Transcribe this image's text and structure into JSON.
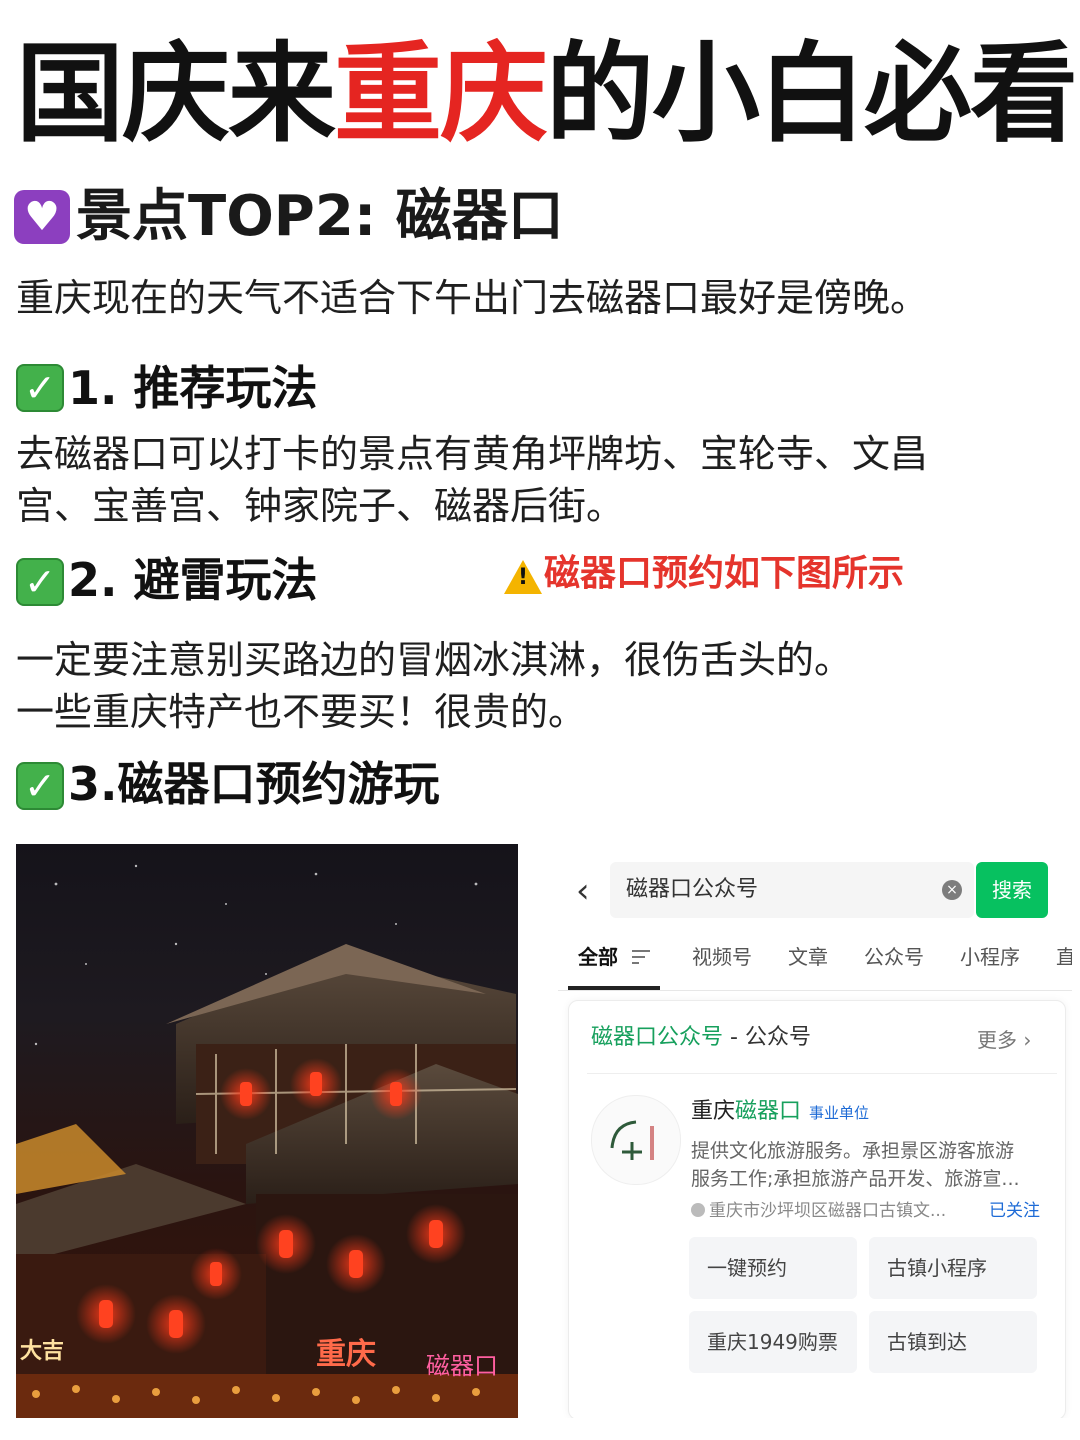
{
  "title": {
    "part1": "国庆来",
    "highlight": "重庆",
    "part2": "的小白必看"
  },
  "section": {
    "heart_icon": "purple-heart",
    "title": "景点TOP2: 磁器口"
  },
  "intro": "重庆现在的天气不适合下午出门去磁器口最好是傍晚。",
  "items": [
    {
      "check_icon": "check-mark",
      "heading": "1. 推荐玩法",
      "lines": [
        "去磁器口可以打卡的景点有黄角坪牌坊、宝轮寺、文昌",
        "宫、宝善宫、钟家院子、磁器后街。"
      ]
    },
    {
      "check_icon": "check-mark",
      "heading": "2. 避雷玩法",
      "lines": [
        "一定要注意别买路边的冒烟冰淇淋，很伤舌头的。",
        "一些重庆特产也不要买！很贵的。"
      ]
    },
    {
      "check_icon": "check-mark",
      "heading": "3.磁器口预约游玩",
      "lines": []
    }
  ],
  "warning": {
    "icon": "warning",
    "mark": "!",
    "text": "磁器口预约如下图所示"
  },
  "photo": {
    "signs": [
      "大吉",
      "重庆",
      "磁器口"
    ]
  },
  "screenshot": {
    "back_icon": "‹",
    "search_value": "磁器口公众号",
    "clear_icon": "×",
    "search_button": "搜索",
    "tabs": [
      "全部",
      "视频号",
      "文章",
      "公众号",
      "小程序",
      "直"
    ],
    "card": {
      "head_green": "磁器口公众号",
      "head_rest": " - 公众号",
      "more": "更多 ›",
      "account_prefix": "重庆",
      "account_green": "磁器口",
      "account_tag": "事业单位",
      "desc_line1": "提供文化旅游服务。承担景区游客旅游",
      "desc_line2": "服务工作;承担旅游产品开发、旅游宣...",
      "location": "重庆市沙坪坝区磁器口古镇文...",
      "followed": "已关注",
      "buttons": [
        "一键预约",
        "古镇小程序",
        "重庆1949购票",
        "古镇到达"
      ]
    }
  },
  "colors": {
    "title_highlight": "#e52521",
    "warning_text": "#e5342c",
    "wechat_green": "#07c160",
    "check_green": "#43b14b",
    "heart_purple": "#8c3fbf"
  }
}
